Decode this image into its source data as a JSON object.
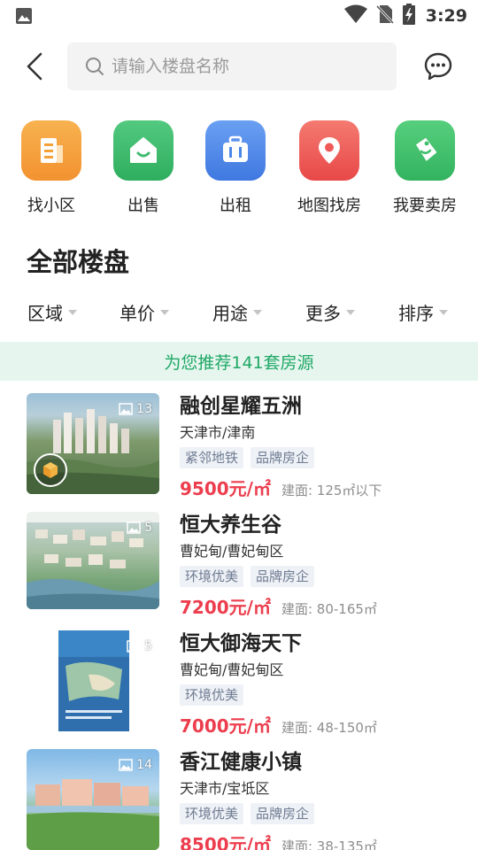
{
  "status": {
    "time": "3:29"
  },
  "search": {
    "placeholder": "请输入楼盘名称"
  },
  "categories": [
    {
      "label": "找小区",
      "color": "#f4a13a"
    },
    {
      "label": "出售",
      "color": "#3dbb6e"
    },
    {
      "label": "出租",
      "color": "#4a86e8"
    },
    {
      "label": "地图找房",
      "color": "#ef5a58"
    },
    {
      "label": "我要卖房",
      "color": "#3fbf6c"
    }
  ],
  "section_title": "全部楼盘",
  "filters": [
    "区域",
    "单价",
    "用途",
    "更多",
    "排序"
  ],
  "banner": "为您推荐141套房源",
  "listings": [
    {
      "name": "融创星耀五洲",
      "location": "天津市/津南",
      "tags": [
        "紧邻地铁",
        "品牌房企"
      ],
      "price": "9500元/㎡",
      "area": "建面: 125㎡以下",
      "photo_count": "13"
    },
    {
      "name": "恒大养生谷",
      "location": "曹妃甸/曹妃甸区",
      "tags": [
        "环境优美",
        "品牌房企"
      ],
      "price": "7200元/㎡",
      "area": "建面: 80-165㎡",
      "photo_count": "5"
    },
    {
      "name": "恒大御海天下",
      "location": "曹妃甸/曹妃甸区",
      "tags": [
        "环境优美"
      ],
      "price": "7000元/㎡",
      "area": "建面: 48-150㎡",
      "photo_count": "5"
    },
    {
      "name": "香江健康小镇",
      "location": "天津市/宝坻区",
      "tags": [
        "环境优美",
        "品牌房企"
      ],
      "price": "8500元/㎡",
      "area": "建面: 38-135㎡",
      "photo_count": "14"
    }
  ],
  "colors": {
    "accent_green": "#1fa865",
    "banner_bg": "#e6f6ef",
    "price_red": "#ec3e4e",
    "tag_bg": "#eef1f6"
  }
}
